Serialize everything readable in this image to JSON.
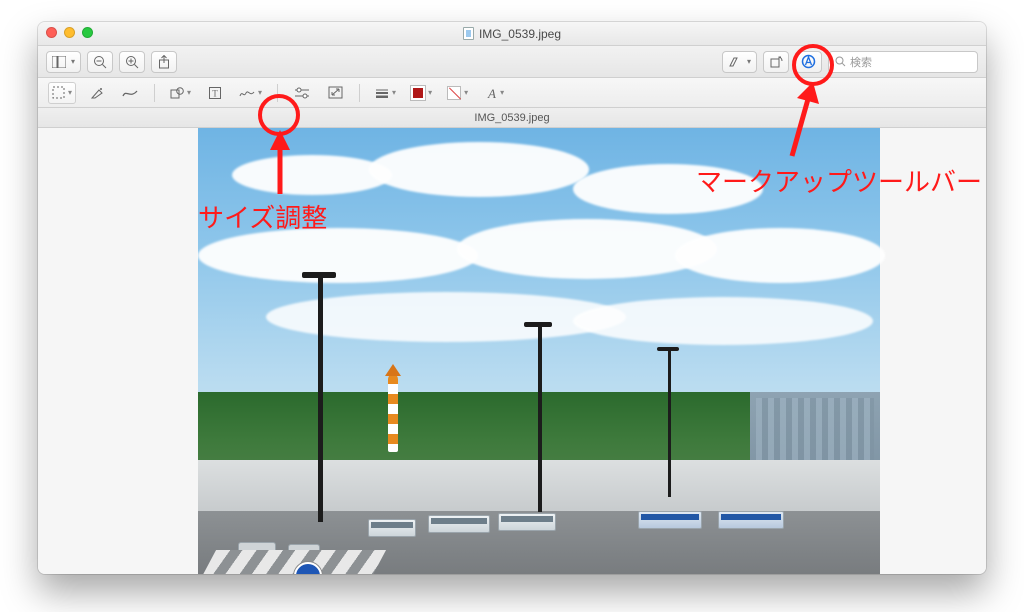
{
  "window": {
    "title": "IMG_0539.jpeg"
  },
  "toolbar": {
    "view_mode_aria": "表示",
    "zoom_out_aria": "縮小",
    "zoom_in_aria": "拡大",
    "share_aria": "共有",
    "highlight_aria": "ハイライト",
    "rotate_aria": "回転",
    "markup_aria": "マークアップ",
    "search_placeholder": "検索"
  },
  "markup": {
    "select_aria": "選択ツール",
    "instant_alpha_aria": "インスタントアルファ",
    "sketch_aria": "スケッチ",
    "shapes_aria": "シェイプ",
    "text_aria": "テキスト",
    "sign_aria": "署名",
    "adjust_color_aria": "カラー調整",
    "adjust_size_aria": "サイズ調整",
    "line_style_aria": "線スタイル",
    "border_color_aria": "枠カラー",
    "fill_color_aria": "塗りつぶし",
    "font_style_aria": "フォント"
  },
  "tabs": {
    "active": "IMG_0539.jpeg"
  },
  "annotations": {
    "size_label": "サイズ調整",
    "markup_label": "マークアップツールバー"
  },
  "colors": {
    "annotation_red": "#ff1a1a",
    "markup_border_color": "#b01818"
  }
}
